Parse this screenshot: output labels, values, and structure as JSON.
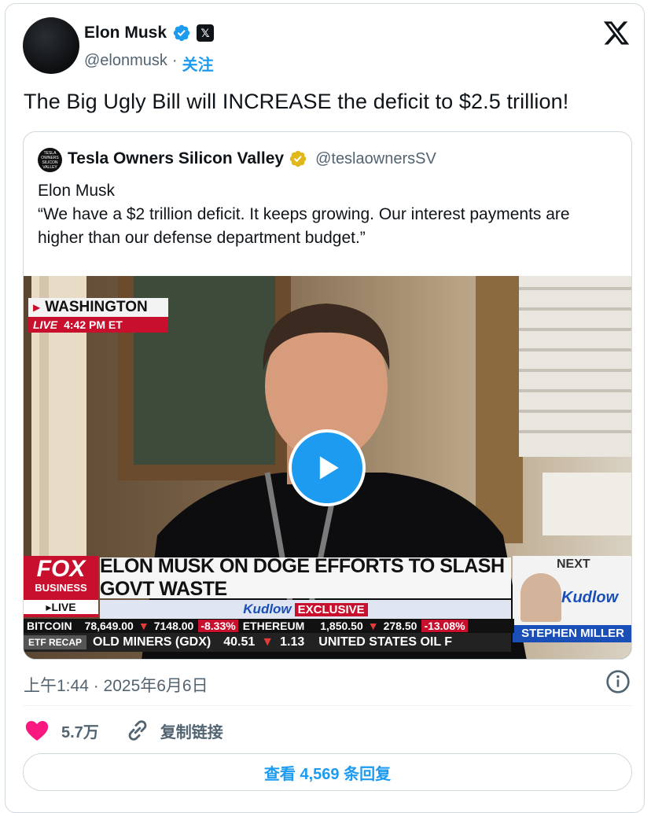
{
  "author": {
    "name": "Elon Musk",
    "handle": "@elonmusk",
    "separator": "·",
    "follow_label": "关注"
  },
  "tweet_text": "The Big Ugly Bill will INCREASE the deficit to $2.5 trillion!",
  "quote": {
    "name": "Tesla Owners Silicon Valley",
    "handle": "@teslaownersSV",
    "avatar_text": "TESLA OWNERS SILICON VALLEY",
    "author_line": "Elon Musk",
    "text": "“We have a $2 trillion deficit. It keeps growing. Our interest payments are higher than our defense department budget.”"
  },
  "video": {
    "location": "WASHINGTON",
    "live_label": "LIVE",
    "time": "4:42 PM ET",
    "network_top": "FOX",
    "network_bottom": "BUSINESS",
    "network_live": "▸LIVE",
    "headline": "ELON MUSK ON DOGE EFFORTS TO SLASH GOVT WASTE",
    "show": "Kudlow",
    "exclusive": "EXCLUSIVE",
    "next_label": "NEXT",
    "next_show": "Kudlow",
    "next_guest": "STEPHEN MILLER",
    "ticker1": {
      "name1": "BITCOIN",
      "price1": "78,649.00",
      "chg1": "7148.00",
      "pct1": "-8.33%",
      "name2": "ETHEREUM",
      "price2": "1,850.50",
      "chg2": "278.50",
      "pct2": "-13.08%"
    },
    "ticker2": {
      "label": "ETF RECAP",
      "item1": "OLD MINERS (GDX)",
      "price1": "40.51",
      "chg1": "1.13",
      "item2": "UNITED STATES OIL F"
    }
  },
  "meta": {
    "timestamp": "上午1:44 · 2025年6月6日"
  },
  "actions": {
    "like_count": "5.7万",
    "copy_link": "复制链接",
    "view_replies": "查看 4,569 条回复"
  },
  "colors": {
    "accent": "#1d9bf0",
    "like": "#f91880",
    "text_secondary": "#536471",
    "fox_red": "#c8102e"
  }
}
